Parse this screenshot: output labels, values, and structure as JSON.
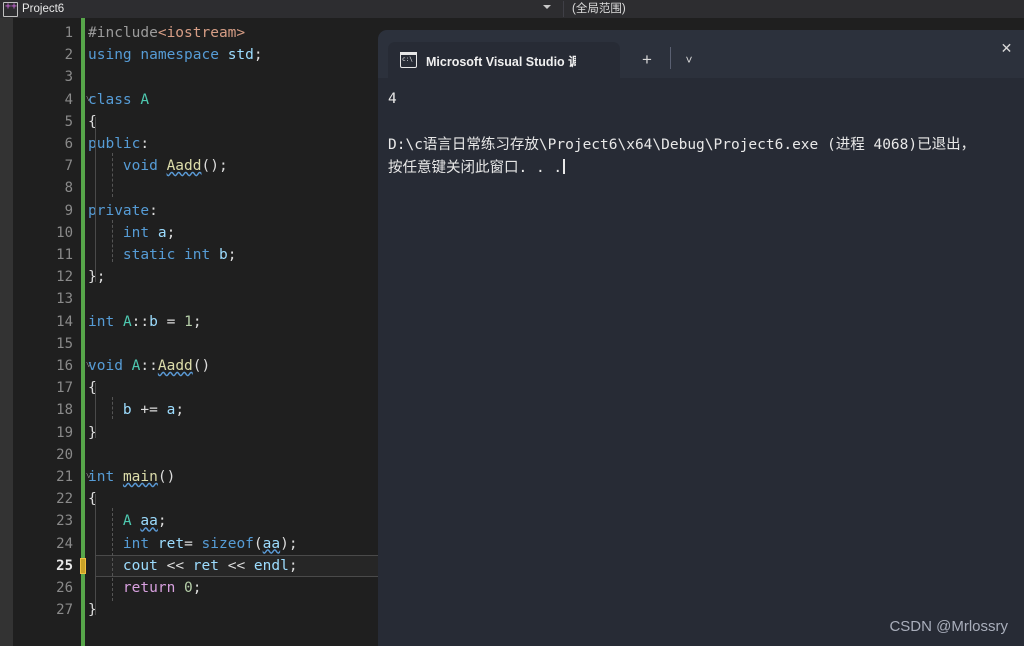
{
  "app": {
    "titlebar": {
      "file_tab_label": "Project6",
      "file_icon": "cpp-file-icon",
      "scope_selector_value": "(全局范围)",
      "dropdown_icon": "chevron-down-icon"
    }
  },
  "editor": {
    "language": "cpp",
    "current_line": 25,
    "total_lines": 27,
    "change_bar_color": "#57a64a",
    "lines": [
      {
        "n": 1,
        "fold": "",
        "text": "#include<iostream>"
      },
      {
        "n": 2,
        "fold": "",
        "text": "using namespace std;"
      },
      {
        "n": 3,
        "fold": "",
        "text": ""
      },
      {
        "n": 4,
        "fold": "v",
        "text": "class A"
      },
      {
        "n": 5,
        "fold": "",
        "text": "{"
      },
      {
        "n": 6,
        "fold": "",
        "text": "public:"
      },
      {
        "n": 7,
        "fold": "",
        "text": "    void Aadd();"
      },
      {
        "n": 8,
        "fold": "",
        "text": ""
      },
      {
        "n": 9,
        "fold": "",
        "text": "private:"
      },
      {
        "n": 10,
        "fold": "",
        "text": "    int a;"
      },
      {
        "n": 11,
        "fold": "",
        "text": "    static int b;"
      },
      {
        "n": 12,
        "fold": "",
        "text": "};"
      },
      {
        "n": 13,
        "fold": "",
        "text": ""
      },
      {
        "n": 14,
        "fold": "",
        "text": "int A::b = 1;"
      },
      {
        "n": 15,
        "fold": "",
        "text": ""
      },
      {
        "n": 16,
        "fold": "v",
        "text": "void A::Aadd()"
      },
      {
        "n": 17,
        "fold": "",
        "text": "{"
      },
      {
        "n": 18,
        "fold": "",
        "text": "    b += a;"
      },
      {
        "n": 19,
        "fold": "",
        "text": "}"
      },
      {
        "n": 20,
        "fold": "",
        "text": ""
      },
      {
        "n": 21,
        "fold": "v",
        "text": "int main()"
      },
      {
        "n": 22,
        "fold": "",
        "text": "{"
      },
      {
        "n": 23,
        "fold": "",
        "text": "    A aa;"
      },
      {
        "n": 24,
        "fold": "",
        "text": "    int ret= sizeof(aa);"
      },
      {
        "n": 25,
        "fold": "",
        "text": "    cout << ret << endl;"
      },
      {
        "n": 26,
        "fold": "",
        "text": "    return 0;"
      },
      {
        "n": 27,
        "fold": "",
        "text": "}"
      }
    ]
  },
  "console": {
    "tab": {
      "icon": "console-window-icon",
      "title": "Microsoft Visual Studio 调试控",
      "close_icon": "close-icon",
      "new_tab_icon": "plus-icon",
      "menu_icon": "chevron-down-icon"
    },
    "output": {
      "program_output": "4",
      "blank": "",
      "exit_message": "D:\\c语言日常练习存放\\Project6\\x64\\Debug\\Project6.exe (进程 4068)已退出，",
      "prompt_message": "按任意键关闭此窗口. . ."
    }
  },
  "watermark": {
    "text": "CSDN @Mrlossry"
  }
}
